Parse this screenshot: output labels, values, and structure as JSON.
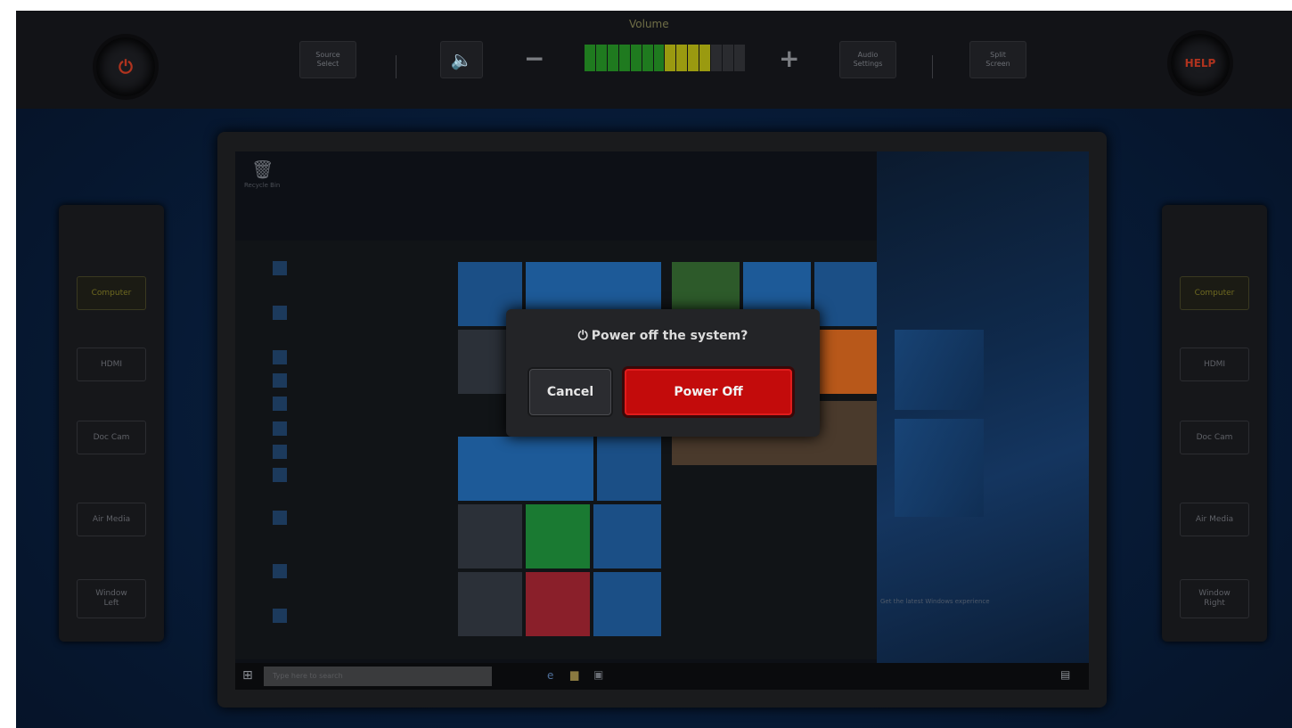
{
  "topbar": {
    "power_icon": "power-icon",
    "source_label": "Source\nSelect",
    "mute_icon": "speaker-icon",
    "vol_minus": "−",
    "vol_plus": "+",
    "volume_label": "Volume",
    "volume_level_fraction": 0.8,
    "audio_label": "Audio\nSettings",
    "split_label": "Split\nScreen",
    "help_label": "HELP"
  },
  "left_panel": {
    "items": [
      {
        "label": "Computer"
      },
      {
        "label": "HDMI"
      },
      {
        "label": "Doc Cam"
      },
      {
        "label": "Air Media"
      },
      {
        "label": "Window\nLeft"
      }
    ]
  },
  "right_panel": {
    "items": [
      {
        "label": "Computer"
      },
      {
        "label": "HDMI"
      },
      {
        "label": "Doc Cam"
      },
      {
        "label": "Air Media"
      },
      {
        "label": "Window\nRight"
      }
    ]
  },
  "screen": {
    "recycle_label": "Recycle Bin",
    "search_placeholder": "Type here to search",
    "news_text": "Get the latest Windows experience"
  },
  "dialog": {
    "title": "Power off the system?",
    "cancel_label": "Cancel",
    "poweroff_label": "Power Off"
  },
  "colors": {
    "accent_red": "#c30b0b",
    "volume_green": "#1f7a1f",
    "volume_yellow": "#9a9a10",
    "volume_red": "#b31212"
  }
}
